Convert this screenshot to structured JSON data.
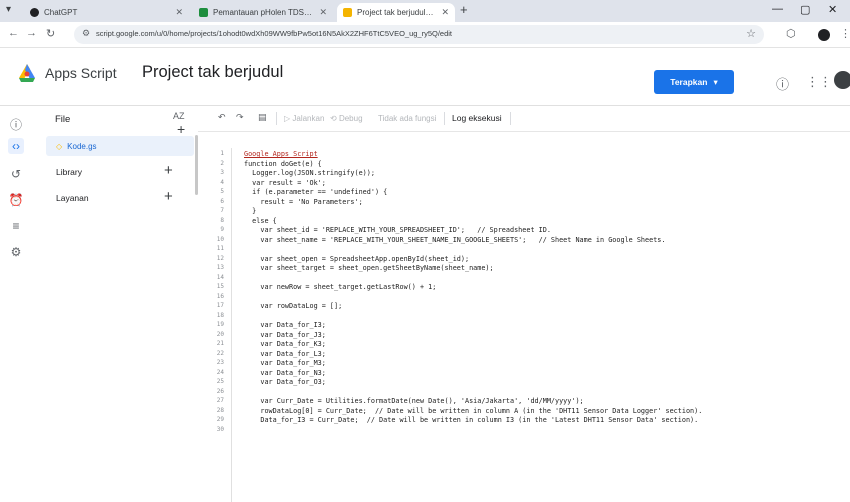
{
  "browser": {
    "tabs": [
      {
        "label": "ChatGPT",
        "color": "#202124",
        "active": false
      },
      {
        "label": "Pemantauan pHolen TDS - Goo",
        "color": "#1e8e3e",
        "active": false
      },
      {
        "label": "Project tak berjudul - Editor Pr",
        "color": "#f4b400",
        "active": true
      }
    ],
    "url": "script.google.com/u/0/home/projects/1ohodt0wdXh09WW9fbPw5ot16N5AkX2ZHF6TtC5VEO_ug_ry5Q/edit"
  },
  "header": {
    "product": "Apps Script",
    "project_title": "Project tak berjudul",
    "deploy_label": "Terapkan",
    "accent": "#1a73e8"
  },
  "sidebar": {
    "title": "File",
    "sort_label": "AZ",
    "file": "Kode.gs",
    "sections": [
      "Library",
      "Layanan"
    ]
  },
  "toolbar": {
    "run": "Jalankan",
    "debug": "Debug",
    "function_select": "Tidak ada fungsi",
    "log": "Log eksekusi"
  },
  "code": [
    {
      "n": "1",
      "t": "Google Apps Script",
      "c": true
    },
    {
      "n": "2",
      "t": "function doGet(e) {"
    },
    {
      "n": "3",
      "t": "  Logger.log(JSON.stringify(e));"
    },
    {
      "n": "4",
      "t": "  var result = 'Ok';"
    },
    {
      "n": "5",
      "t": "  if (e.parameter == 'undefined') {"
    },
    {
      "n": "6",
      "t": "    result = 'No Parameters';"
    },
    {
      "n": "7",
      "t": "  }"
    },
    {
      "n": "8",
      "t": "  else {"
    },
    {
      "n": "9",
      "t": "    var sheet_id = 'REPLACE_WITH_YOUR_SPREADSHEET_ID';   // Spreadsheet ID."
    },
    {
      "n": "10",
      "t": "    var sheet_name = 'REPLACE_WITH_YOUR_SHEET_NAME_IN_GOOGLE_SHEETS';   // Sheet Name in Google Sheets."
    },
    {
      "n": "11",
      "t": ""
    },
    {
      "n": "12",
      "t": "    var sheet_open = SpreadsheetApp.openById(sheet_id);"
    },
    {
      "n": "13",
      "t": "    var sheet_target = sheet_open.getSheetByName(sheet_name);"
    },
    {
      "n": "14",
      "t": ""
    },
    {
      "n": "15",
      "t": "    var newRow = sheet_target.getLastRow() + 1;"
    },
    {
      "n": "16",
      "t": ""
    },
    {
      "n": "17",
      "t": "    var rowDataLog = [];"
    },
    {
      "n": "18",
      "t": ""
    },
    {
      "n": "19",
      "t": "    var Data_for_I3;"
    },
    {
      "n": "20",
      "t": "    var Data_for_J3;"
    },
    {
      "n": "21",
      "t": "    var Data_for_K3;"
    },
    {
      "n": "22",
      "t": "    var Data_for_L3;"
    },
    {
      "n": "23",
      "t": "    var Data_for_M3;"
    },
    {
      "n": "24",
      "t": "    var Data_for_N3;"
    },
    {
      "n": "25",
      "t": "    var Data_for_O3;"
    },
    {
      "n": "26",
      "t": ""
    },
    {
      "n": "27",
      "t": "    var Curr_Date = Utilities.formatDate(new Date(), 'Asia/Jakarta', 'dd/MM/yyyy');"
    },
    {
      "n": "28",
      "t": "    rowDataLog[0] = Curr_Date;  // Date will be written in column A (in the 'DHT11 Sensor Data Logger' section)."
    },
    {
      "n": "29",
      "t": "    Data_for_I3 = Curr_Date;  // Date will be written in column I3 (in the 'Latest DHT11 Sensor Data' section)."
    },
    {
      "n": "30",
      "t": ""
    }
  ]
}
